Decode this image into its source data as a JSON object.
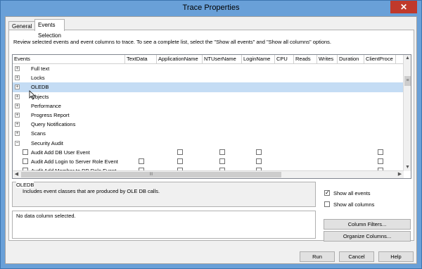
{
  "window": {
    "title": "Trace Properties",
    "close_glyph": "✕"
  },
  "tabs": [
    {
      "label": "General",
      "active": false
    },
    {
      "label": "Events Selection",
      "active": true
    }
  ],
  "instructions": "Review selected events and event columns to trace. To see a complete list, select the \"Show all events\" and \"Show all columns\" options.",
  "grid": {
    "columns": [
      "Events",
      "TextData",
      "ApplicationName",
      "NTUserName",
      "LoginName",
      "CPU",
      "Reads",
      "Writes",
      "Duration",
      "ClientProce"
    ],
    "rows": [
      {
        "label": "Full text",
        "type": "category",
        "expanded": false,
        "selected": false
      },
      {
        "label": "Locks",
        "type": "category",
        "expanded": false,
        "selected": false
      },
      {
        "label": "OLEDB",
        "type": "category",
        "expanded": false,
        "selected": true
      },
      {
        "label": "Objects",
        "type": "category",
        "expanded": false,
        "selected": false
      },
      {
        "label": "Performance",
        "type": "category",
        "expanded": false,
        "selected": false
      },
      {
        "label": "Progress Report",
        "type": "category",
        "expanded": false,
        "selected": false
      },
      {
        "label": "Query Notifications",
        "type": "category",
        "expanded": false,
        "selected": false
      },
      {
        "label": "Scans",
        "type": "category",
        "expanded": false,
        "selected": false
      },
      {
        "label": "Security Audit",
        "type": "category",
        "expanded": true,
        "selected": false
      },
      {
        "label": "Audit Add DB User Event",
        "type": "event",
        "selected": false
      },
      {
        "label": "Audit Add Login to Server Role Event",
        "type": "event",
        "selected": false
      },
      {
        "label": "Audit Add Member to DB Role Event",
        "type": "event",
        "selected": false
      }
    ],
    "expander_collapsed": "+",
    "expander_expanded": "−",
    "scroll_thumb_glyph": "III",
    "vscroll_glyph": "≡"
  },
  "description": {
    "title": "OLEDB",
    "text": "Includes event classes that are produced by OLE DB calls."
  },
  "options": {
    "show_all_events": {
      "label": "Show all events",
      "checked": true
    },
    "show_all_columns": {
      "label": "Show all columns",
      "checked": false
    }
  },
  "data_column": {
    "text": "No data column selected."
  },
  "buttons": {
    "column_filters": "Column Filters...",
    "organize_columns": "Organize Columns...",
    "run": "Run",
    "cancel": "Cancel",
    "help": "Help"
  }
}
